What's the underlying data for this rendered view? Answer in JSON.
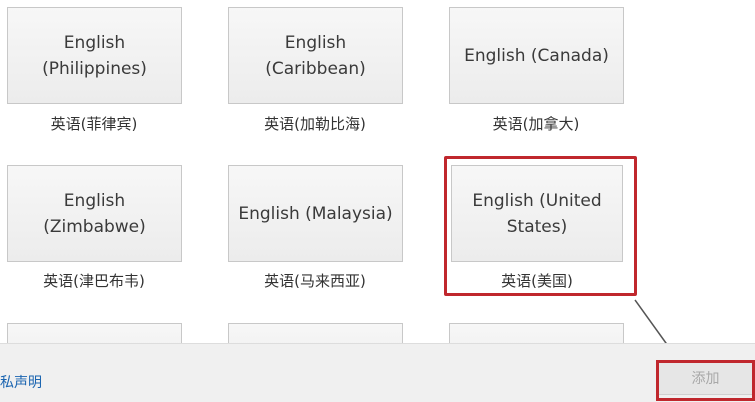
{
  "languages": [
    {
      "tile": "English (Philippines)",
      "caption": "英语(菲律宾)"
    },
    {
      "tile": "English (Caribbean)",
      "caption": "英语(加勒比海)"
    },
    {
      "tile": "English (Canada)",
      "caption": "英语(加拿大)"
    },
    {
      "tile": "English (Zimbabwe)",
      "caption": "英语(津巴布韦)"
    },
    {
      "tile": "English (Malaysia)",
      "caption": "英语(马来西亚)"
    },
    {
      "tile": "English (United States)",
      "caption": "英语(美国)"
    }
  ],
  "footer": {
    "privacy_link": "私声明",
    "add_button": "添加"
  },
  "colors": {
    "highlight": "#c0272d",
    "link": "#1a64b0"
  }
}
